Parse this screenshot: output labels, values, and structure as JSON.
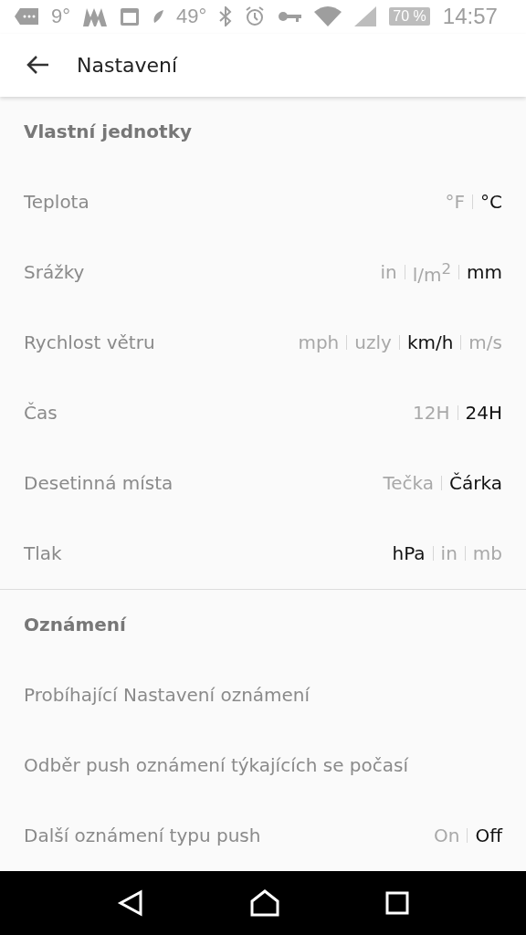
{
  "status_bar": {
    "temp_small": "9°",
    "temp": "49°",
    "battery": "70 %",
    "time": "14:57"
  },
  "app_bar": {
    "title": "Nastavení"
  },
  "sections": [
    {
      "title": "Vlastní jednotky",
      "rows": [
        {
          "label": "Teplota",
          "options": [
            {
              "label": "°F",
              "selected": false
            },
            {
              "label": "°C",
              "selected": true
            }
          ]
        },
        {
          "label": "Srážky",
          "options": [
            {
              "label": "in",
              "selected": false
            },
            {
              "label": "l/m$^{2}$",
              "selected": false
            },
            {
              "label": "mm",
              "selected": true
            }
          ]
        },
        {
          "label": "Rychlost větru",
          "options": [
            {
              "label": "mph",
              "selected": false
            },
            {
              "label": "uzly",
              "selected": false
            },
            {
              "label": "km/h",
              "selected": true
            },
            {
              "label": "m/s",
              "selected": false
            }
          ]
        },
        {
          "label": "Čas",
          "options": [
            {
              "label": "12H",
              "selected": false
            },
            {
              "label": "24H",
              "selected": true
            }
          ]
        },
        {
          "label": "Desetinná místa",
          "options": [
            {
              "label": "Tečka",
              "selected": false
            },
            {
              "label": "Čárka",
              "selected": true
            }
          ]
        },
        {
          "label": "Tlak",
          "options": [
            {
              "label": "hPa",
              "selected": true
            },
            {
              "label": "in",
              "selected": false
            },
            {
              "label": "mb",
              "selected": false
            }
          ]
        }
      ]
    },
    {
      "title": "Oznámení",
      "rows": [
        {
          "label": "Probíhající Nastavení oznámení"
        },
        {
          "label": "Odběr push oznámení týkajících se počasí"
        },
        {
          "label": "Další oznámení typu push",
          "options": [
            {
              "label": "On",
              "selected": false
            },
            {
              "label": "Off",
              "selected": true
            }
          ]
        }
      ]
    }
  ]
}
